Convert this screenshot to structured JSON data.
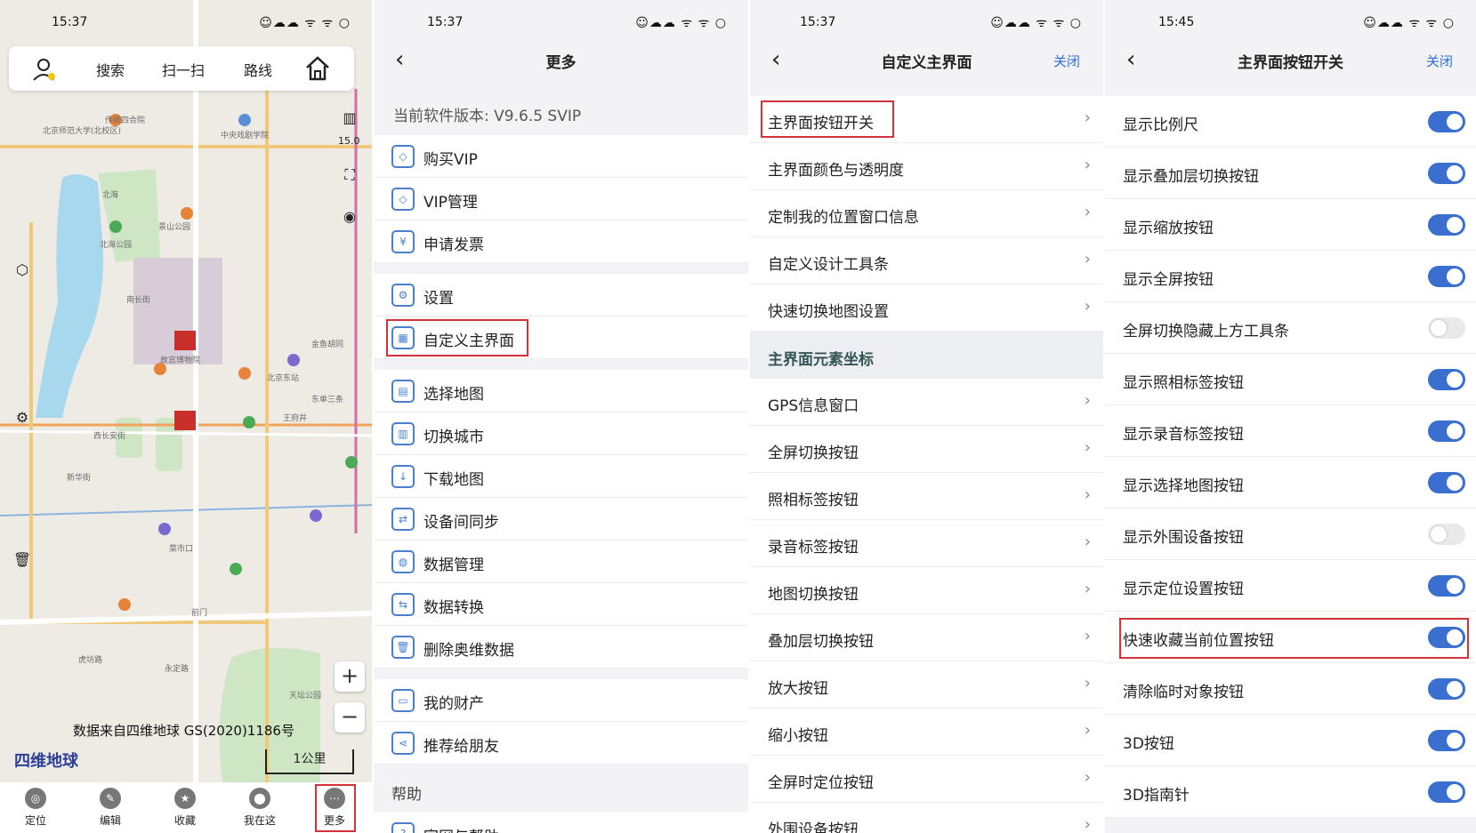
{
  "panel_map": {
    "status_time": "15:37",
    "status_icons": "☺☁☁ ᯤ ᯤ ○",
    "topbar": {
      "search": "搜索",
      "scan": "扫一扫",
      "route": "路线"
    },
    "attribution": "数据来自四维地球 GS(2020)1186号",
    "logo": "四维地球",
    "scale": "1公里",
    "zoom_level": "15.0",
    "map_labels": [
      "北京师范大学(北校区)",
      "传统四合院",
      "中央戏剧学院",
      "北海公园",
      "北海",
      "景山公园",
      "故宫博物院",
      "西长安街",
      "王府井",
      "前门",
      "天坛公园",
      "永定路",
      "东单三条",
      "金鱼胡同",
      "北京东站",
      "菜市口",
      "虎坊路",
      "新华街",
      "南长街"
    ],
    "bottom_nav": [
      "定位",
      "编辑",
      "收藏",
      "我在这",
      "更多"
    ]
  },
  "panel_more": {
    "status_time": "15:37",
    "title": "更多",
    "version": "当前软件版本: V9.6.5 SVIP",
    "items": [
      {
        "icon": "diamond-icon",
        "label": "购买VIP"
      },
      {
        "icon": "diamond-icon",
        "label": "VIP管理"
      },
      {
        "icon": "invoice-icon",
        "label": "申请发票"
      },
      {
        "icon": "gear-icon",
        "label": "设置"
      },
      {
        "icon": "grid-icon",
        "label": "自定义主界面"
      },
      {
        "icon": "map-icon",
        "label": "选择地图"
      },
      {
        "icon": "city-icon",
        "label": "切换城市"
      },
      {
        "icon": "download-icon",
        "label": "下载地图"
      },
      {
        "icon": "sync-icon",
        "label": "设备间同步"
      },
      {
        "icon": "globe-icon",
        "label": "数据管理"
      },
      {
        "icon": "convert-icon",
        "label": "数据转换"
      },
      {
        "icon": "trash-icon",
        "label": "删除奥维数据"
      },
      {
        "icon": "wallet-icon",
        "label": "我的财产"
      },
      {
        "icon": "share-icon",
        "label": "推荐给朋友"
      }
    ],
    "help_header": "帮助",
    "help_item": "官网与帮助"
  },
  "panel_custom": {
    "status_time": "15:37",
    "title": "自定义主界面",
    "close": "关闭",
    "items": [
      "主界面按钮开关",
      "主界面颜色与透明度",
      "定制我的位置窗口信息",
      "自定义设计工具条",
      "快速切换地图设置"
    ],
    "group_header": "主界面元素坐标",
    "group_items": [
      "GPS信息窗口",
      "全屏切换按钮",
      "照相标签按钮",
      "录音标签按钮",
      "地图切换按钮",
      "叠加层切换按钮",
      "放大按钮",
      "缩小按钮",
      "全屏时定位按钮",
      "外围设备按钮"
    ]
  },
  "panel_switches": {
    "status_time": "15:45",
    "title": "主界面按钮开关",
    "close": "关闭",
    "items": [
      {
        "label": "显示比例尺",
        "on": true
      },
      {
        "label": "显示叠加层切换按钮",
        "on": true
      },
      {
        "label": "显示缩放按钮",
        "on": true
      },
      {
        "label": "显示全屏按钮",
        "on": true
      },
      {
        "label": "全屏切换隐藏上方工具条",
        "on": false
      },
      {
        "label": "显示照相标签按钮",
        "on": true
      },
      {
        "label": "显示录音标签按钮",
        "on": true
      },
      {
        "label": "显示选择地图按钮",
        "on": true
      },
      {
        "label": "显示外围设备按钮",
        "on": false
      },
      {
        "label": "显示定位设置按钮",
        "on": true
      },
      {
        "label": "快速收藏当前位置按钮",
        "on": true
      },
      {
        "label": "清除临时对象按钮",
        "on": true
      },
      {
        "label": "3D按钮",
        "on": true
      },
      {
        "label": "3D指南针",
        "on": true
      }
    ]
  },
  "colors": {
    "accent": "#3a6fcf",
    "highlight": "#d4323a"
  }
}
